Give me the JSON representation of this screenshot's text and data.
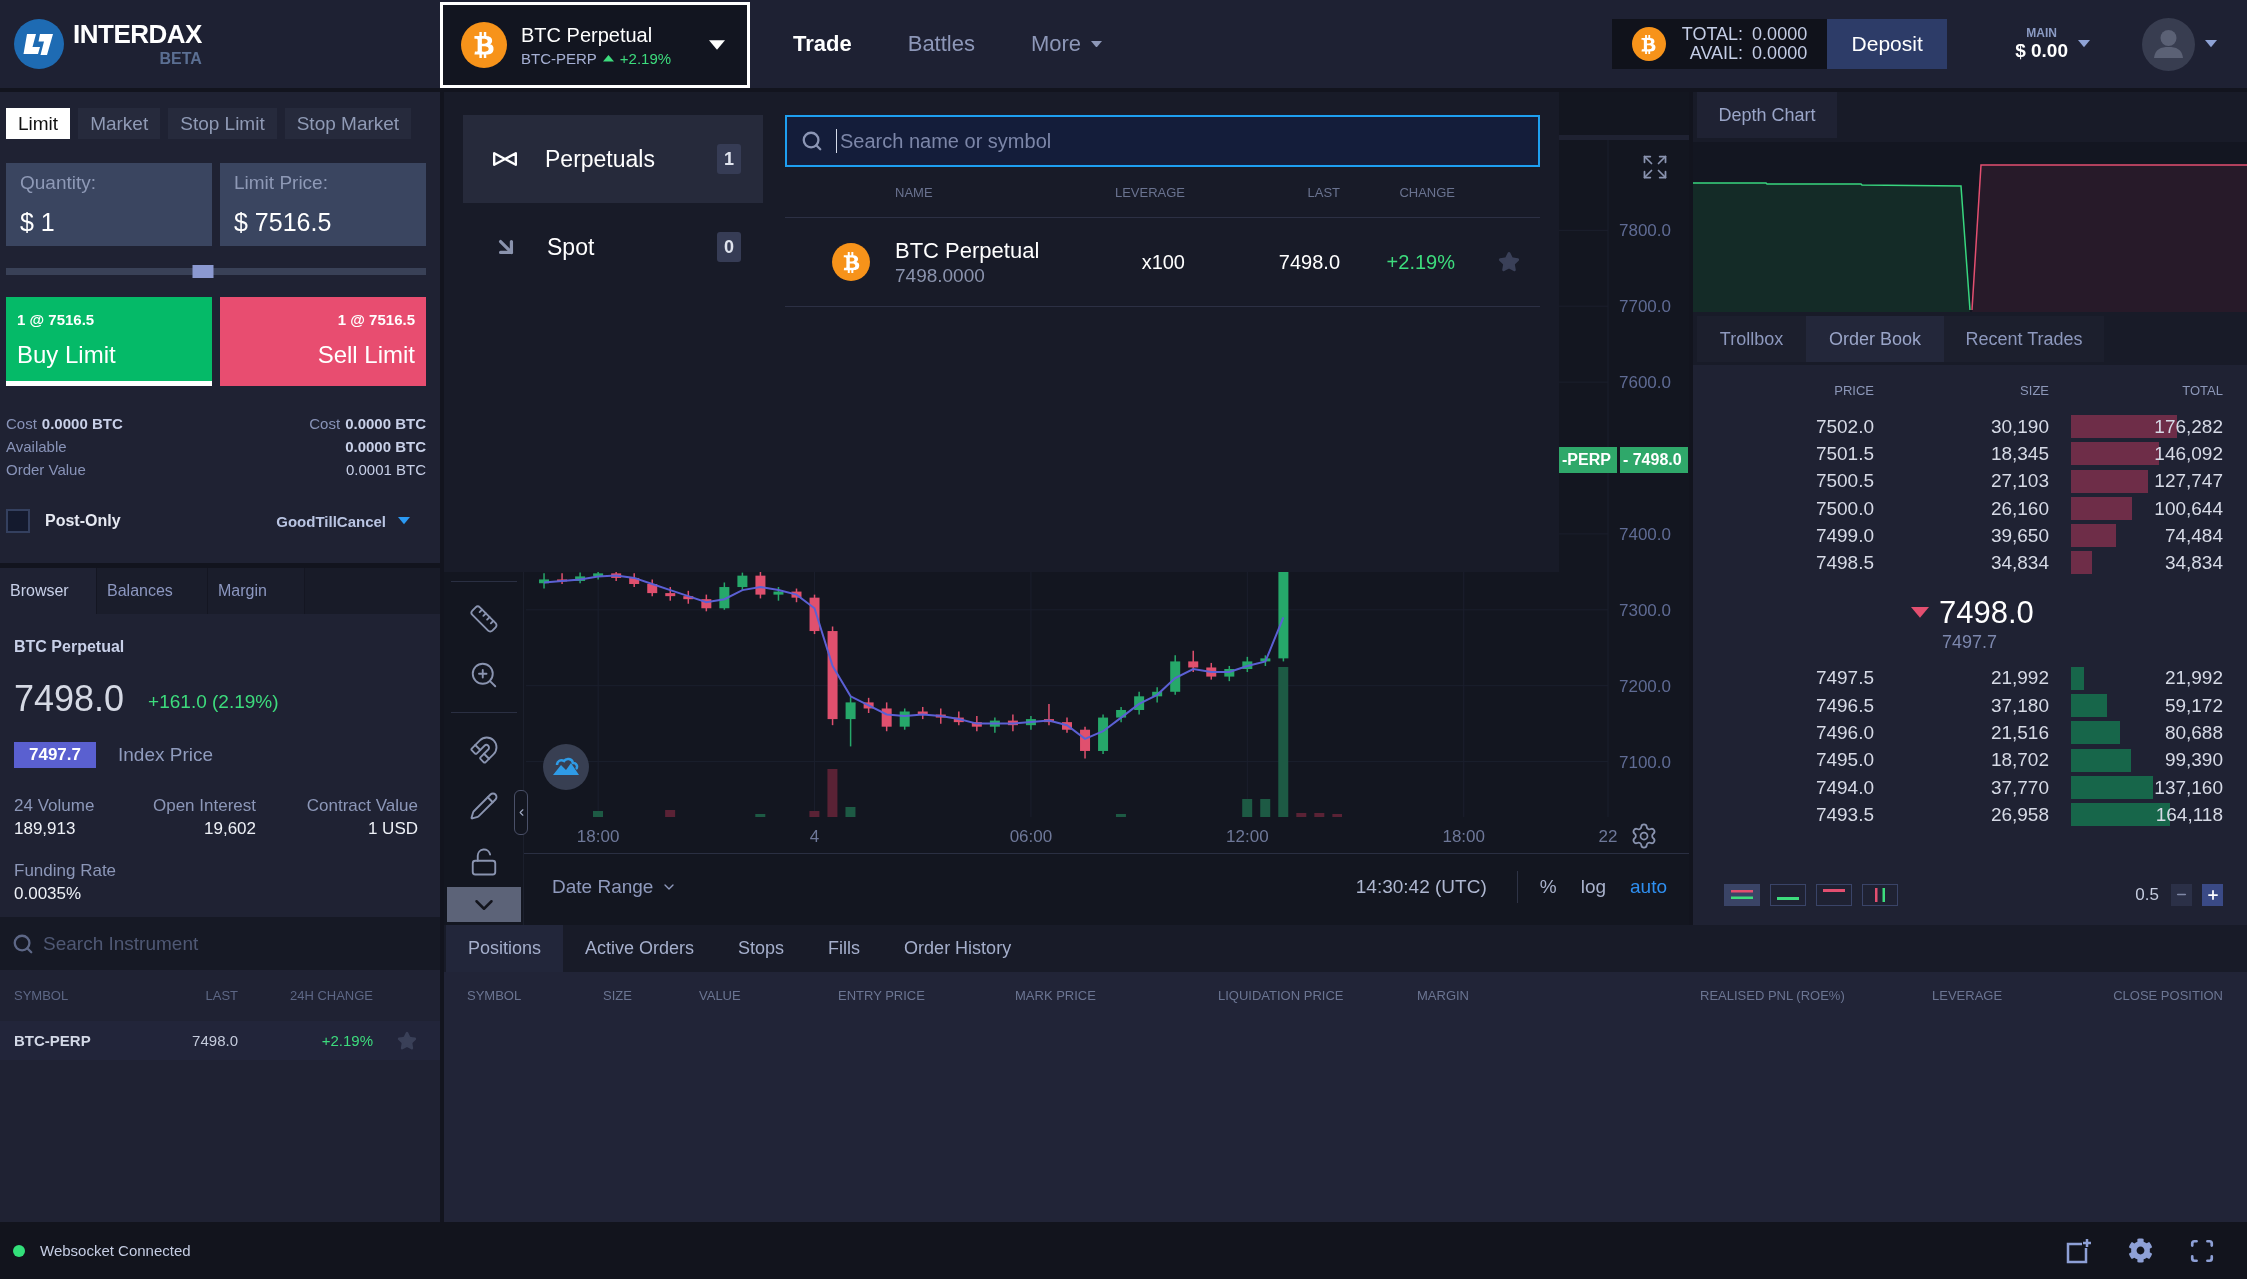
{
  "header": {
    "logo": {
      "name": "INTERDAX",
      "badge": "BETA"
    },
    "market_selector": {
      "name": "BTC Perpetual",
      "symbol": "BTC-PERP",
      "change": "+2.19%",
      "rising": true,
      "open": true
    },
    "nav": [
      {
        "label": "Trade",
        "selected": true,
        "kind": "link"
      },
      {
        "label": "Battles",
        "selected": false,
        "kind": "link"
      },
      {
        "label": "More",
        "selected": false,
        "kind": "menu"
      }
    ],
    "wallet": {
      "total_label": "TOTAL:",
      "total": "0.0000",
      "avail_label": "AVAIL:",
      "avail": "0.0000"
    },
    "deposit_button": "Deposit",
    "account": {
      "label": "MAIN",
      "balance": "$ 0.00"
    }
  },
  "market_menu": {
    "categories": [
      {
        "label": "Perpetuals",
        "count": "1",
        "kind": "perpetual",
        "selected": true
      },
      {
        "label": "Spot",
        "count": "0",
        "kind": "spot",
        "selected": false
      }
    ],
    "search": {
      "placeholder": "Search name or symbol"
    },
    "columns": [
      "NAME",
      "LEVERAGE",
      "LAST",
      "CHANGE"
    ],
    "rows": [
      {
        "name": "BTC Perpetual",
        "price": "7498.0000",
        "leverage": "x100",
        "last": "7498.0",
        "change": "+2.19%",
        "favorite": false
      }
    ]
  },
  "order_form": {
    "order_types": [
      {
        "label": "Limit",
        "selected": true
      },
      {
        "label": "Market",
        "selected": false
      },
      {
        "label": "Stop Limit",
        "selected": false
      },
      {
        "label": "Stop Market",
        "selected": false
      }
    ],
    "quantity": {
      "label": "Quantity:",
      "value": "$ 1"
    },
    "limit_price": {
      "label": "Limit Price:",
      "value": "$ 7516.5"
    },
    "size_slider": {
      "level": 0.47
    },
    "sides": [
      {
        "kind": "buy",
        "summary": "1 @ 7516.5",
        "label": "Buy Limit",
        "selected": true
      },
      {
        "kind": "sell",
        "summary": "1 @ 7516.5",
        "label": "Sell Limit",
        "selected": false
      }
    ],
    "summary_rows": [
      {
        "left_label": "Cost",
        "left_value": "0.0000 BTC",
        "right_label": "Cost",
        "right_value": "0.0000 BTC",
        "strong": true
      },
      {
        "left_label": "Available",
        "right_value": "0.0000 BTC",
        "strong": true
      },
      {
        "left_label": "Order Value",
        "right_value": "0.0001 BTC",
        "strong": false
      }
    ],
    "post_only": {
      "label": "Post-Only",
      "checked": false
    },
    "time_in_force": "GoodTillCancel"
  },
  "info_panel": {
    "tabs": [
      {
        "label": "Browser",
        "selected": true
      },
      {
        "label": "Balances",
        "selected": false
      },
      {
        "label": "Margin",
        "selected": false
      }
    ],
    "instrument": {
      "name": "BTC Perpetual",
      "last": "7498.0",
      "change": "+161.0 (2.19%)",
      "index_price": "7497.7",
      "index_label": "Index Price",
      "stats": [
        {
          "label": "24 Volume",
          "value": "189,913"
        },
        {
          "label": "Open Interest",
          "value": "19,602"
        },
        {
          "label": "Contract Value",
          "value": "1 USD"
        },
        {
          "label": "Funding Rate",
          "value": "0.0035%"
        }
      ]
    },
    "search": {
      "placeholder": "Search Instrument"
    },
    "table": {
      "columns": [
        "SYMBOL",
        "LAST",
        "24H CHANGE"
      ],
      "rows": [
        {
          "symbol": "BTC-PERP",
          "last": "7498.0",
          "change": "+2.19%",
          "favorite": false
        }
      ]
    }
  },
  "chart": {
    "chart_data": [
      {
        "type": "candlestick",
        "categories": [
          null,
          null,
          null,
          "18:00",
          null,
          null,
          null,
          null,
          null,
          null,
          null,
          null,
          null,
          null,
          null,
          "4",
          null,
          null,
          null,
          null,
          null,
          null,
          null,
          null,
          null,
          null,
          null,
          "06:00",
          null,
          null,
          null,
          null,
          null,
          null,
          null,
          null,
          null,
          null,
          null,
          "12:00",
          null,
          null,
          null,
          null,
          null,
          null,
          null,
          null,
          null,
          null,
          null,
          "18:00",
          null,
          null,
          null,
          null,
          null,
          null,
          null,
          "22"
        ],
        "ylim": [
          7027,
          7919
        ],
        "yticks": [
          {
            "value": 7100,
            "label": "7100.0"
          },
          {
            "value": 7200,
            "label": "7200.0"
          },
          {
            "value": 7300,
            "label": "7300.0"
          },
          {
            "value": 7400,
            "label": "7400.0"
          },
          {
            "value": 7600,
            "label": "7600.0"
          },
          {
            "value": 7700,
            "label": "7700.0"
          },
          {
            "value": 7800,
            "label": "7800.0"
          }
        ],
        "grid": true,
        "series": [
          {
            "type": "candlestick",
            "ohlc": [
              [
                7335,
                7348,
                7328,
                7340
              ],
              [
                7340,
                7348,
                7334,
                7338
              ],
              [
                7338,
                7349,
                7335,
                7344
              ],
              [
                7344,
                7350,
                7340,
                7348
              ],
              [
                7348,
                7350,
                7338,
                7342
              ],
              [
                7342,
                7348,
                7330,
                7334
              ],
              [
                7334,
                7340,
                7318,
                7322
              ],
              [
                7322,
                7330,
                7312,
                7318
              ],
              [
                7318,
                7325,
                7308,
                7314
              ],
              [
                7314,
                7320,
                7298,
                7302
              ],
              [
                7302,
                7336,
                7300,
                7330
              ],
              [
                7330,
                7349,
                7325,
                7345
              ],
              [
                7345,
                7350,
                7315,
                7320
              ],
              [
                7320,
                7330,
                7312,
                7324
              ],
              [
                7324,
                7328,
                7310,
                7316
              ],
              [
                7316,
                7320,
                7268,
                7272
              ],
              [
                7272,
                7278,
                7148,
                7156
              ],
              [
                7156,
                7185,
                7120,
                7178
              ],
              [
                7178,
                7184,
                7164,
                7170
              ],
              [
                7170,
                7178,
                7140,
                7146
              ],
              [
                7146,
                7170,
                7142,
                7166
              ],
              [
                7166,
                7172,
                7156,
                7162
              ],
              [
                7162,
                7170,
                7150,
                7158
              ],
              [
                7158,
                7166,
                7148,
                7152
              ],
              [
                7152,
                7160,
                7140,
                7146
              ],
              [
                7146,
                7158,
                7138,
                7154
              ],
              [
                7154,
                7162,
                7140,
                7148
              ],
              [
                7148,
                7160,
                7142,
                7156
              ],
              [
                7156,
                7176,
                7148,
                7152
              ],
              [
                7152,
                7158,
                7138,
                7142
              ],
              [
                7142,
                7146,
                7104,
                7114
              ],
              [
                7114,
                7162,
                7110,
                7158
              ],
              [
                7158,
                7172,
                7152,
                7168
              ],
              [
                7168,
                7192,
                7162,
                7186
              ],
              [
                7186,
                7198,
                7178,
                7192
              ],
              [
                7192,
                7240,
                7188,
                7232
              ],
              [
                7232,
                7246,
                7218,
                7224
              ],
              [
                7224,
                7230,
                7208,
                7212
              ],
              [
                7212,
                7226,
                7206,
                7222
              ],
              [
                7222,
                7238,
                7218,
                7232
              ],
              [
                7232,
                7240,
                7226,
                7236
              ],
              [
                7236,
                7352,
                7232,
                7352
              ],
              null,
              null,
              null,
              null,
              null,
              null,
              null,
              null,
              null,
              null,
              null,
              null,
              null,
              null,
              null,
              null,
              null,
              null
            ]
          },
          {
            "type": "line",
            "color": "#5b60d4",
            "values": [
              7336,
              7338,
              7340,
              7344,
              7345,
              7342,
              7334,
              7326,
              7318,
              7310,
              7314,
              7326,
              7330,
              7326,
              7320,
              7302,
              7226,
              7186,
              7174,
              7162,
              7160,
              7162,
              7160,
              7156,
              7150,
              7150,
              7150,
              7152,
              7154,
              7148,
              7130,
              7140,
              7158,
              7176,
              7188,
              7210,
              7222,
              7218,
              7218,
              7226,
              7232,
              7290,
              null,
              null,
              null,
              null,
              null,
              null,
              null,
              null,
              null,
              null,
              null,
              null,
              null,
              null,
              null,
              null,
              null,
              null
            ]
          }
        ]
      }
    ],
    "price_tag": {
      "symbol": "-PERP",
      "price": "- 7498.0"
    },
    "footer": {
      "date_range": "Date Range",
      "clock": "14:30:42 (UTC)",
      "scale_options": [
        {
          "label": "%",
          "selected": false
        },
        {
          "label": "log",
          "selected": false
        },
        {
          "label": "auto",
          "selected": true
        }
      ]
    }
  },
  "depth_panel": {
    "tabs": [
      {
        "label": "Depth Chart",
        "selected": true
      }
    ]
  },
  "order_book": {
    "tabs": [
      {
        "label": "Trollbox",
        "selected": false
      },
      {
        "label": "Order Book",
        "selected": true
      },
      {
        "label": "Recent Trades",
        "selected": false
      }
    ],
    "columns": [
      "PRICE",
      "SIZE",
      "TOTAL"
    ],
    "asks": [
      {
        "price": "7502.0",
        "size": "30,190",
        "total": "176,282",
        "level": 1.0
      },
      {
        "price": "7501.5",
        "size": "18,345",
        "total": "146,092",
        "level": 0.829
      },
      {
        "price": "7500.5",
        "size": "27,103",
        "total": "127,747",
        "level": 0.725
      },
      {
        "price": "7500.0",
        "size": "26,160",
        "total": "100,644",
        "level": 0.571
      },
      {
        "price": "7499.0",
        "size": "39,650",
        "total": "74,484",
        "level": 0.423
      },
      {
        "price": "7498.5",
        "size": "34,834",
        "total": "34,834",
        "level": 0.198
      }
    ],
    "last_price": "7498.0",
    "rising": false,
    "index_price": "7497.7",
    "bids": [
      {
        "price": "7497.5",
        "size": "21,992",
        "total": "21,992",
        "level": 0.125
      },
      {
        "price": "7496.5",
        "size": "37,180",
        "total": "59,172",
        "level": 0.336
      },
      {
        "price": "7496.0",
        "size": "21,516",
        "total": "80,688",
        "level": 0.458
      },
      {
        "price": "7495.0",
        "size": "18,702",
        "total": "99,390",
        "level": 0.564
      },
      {
        "price": "7494.0",
        "size": "37,770",
        "total": "137,160",
        "level": 0.778
      },
      {
        "price": "7493.5",
        "size": "26,958",
        "total": "164,118",
        "level": 0.931
      }
    ],
    "views": [
      {
        "kind": "both",
        "selected": true
      },
      {
        "kind": "bids",
        "selected": false
      },
      {
        "kind": "asks",
        "selected": false
      },
      {
        "kind": "columns",
        "selected": false
      }
    ],
    "step": "0.5"
  },
  "bottom_panel": {
    "tabs": [
      {
        "label": "Positions",
        "selected": true
      },
      {
        "label": "Active Orders",
        "selected": false
      },
      {
        "label": "Stops",
        "selected": false
      },
      {
        "label": "Fills",
        "selected": false
      },
      {
        "label": "Order History",
        "selected": false
      }
    ],
    "columns": [
      "SYMBOL",
      "SIZE",
      "VALUE",
      "ENTRY PRICE",
      "MARK PRICE",
      "LIQUIDATION PRICE",
      "MARGIN",
      "REALISED PNL (ROE%)",
      "LEVERAGE",
      "CLOSE POSITION"
    ]
  },
  "status_bar": {
    "connection": "Websocket Connected",
    "connected": true
  }
}
